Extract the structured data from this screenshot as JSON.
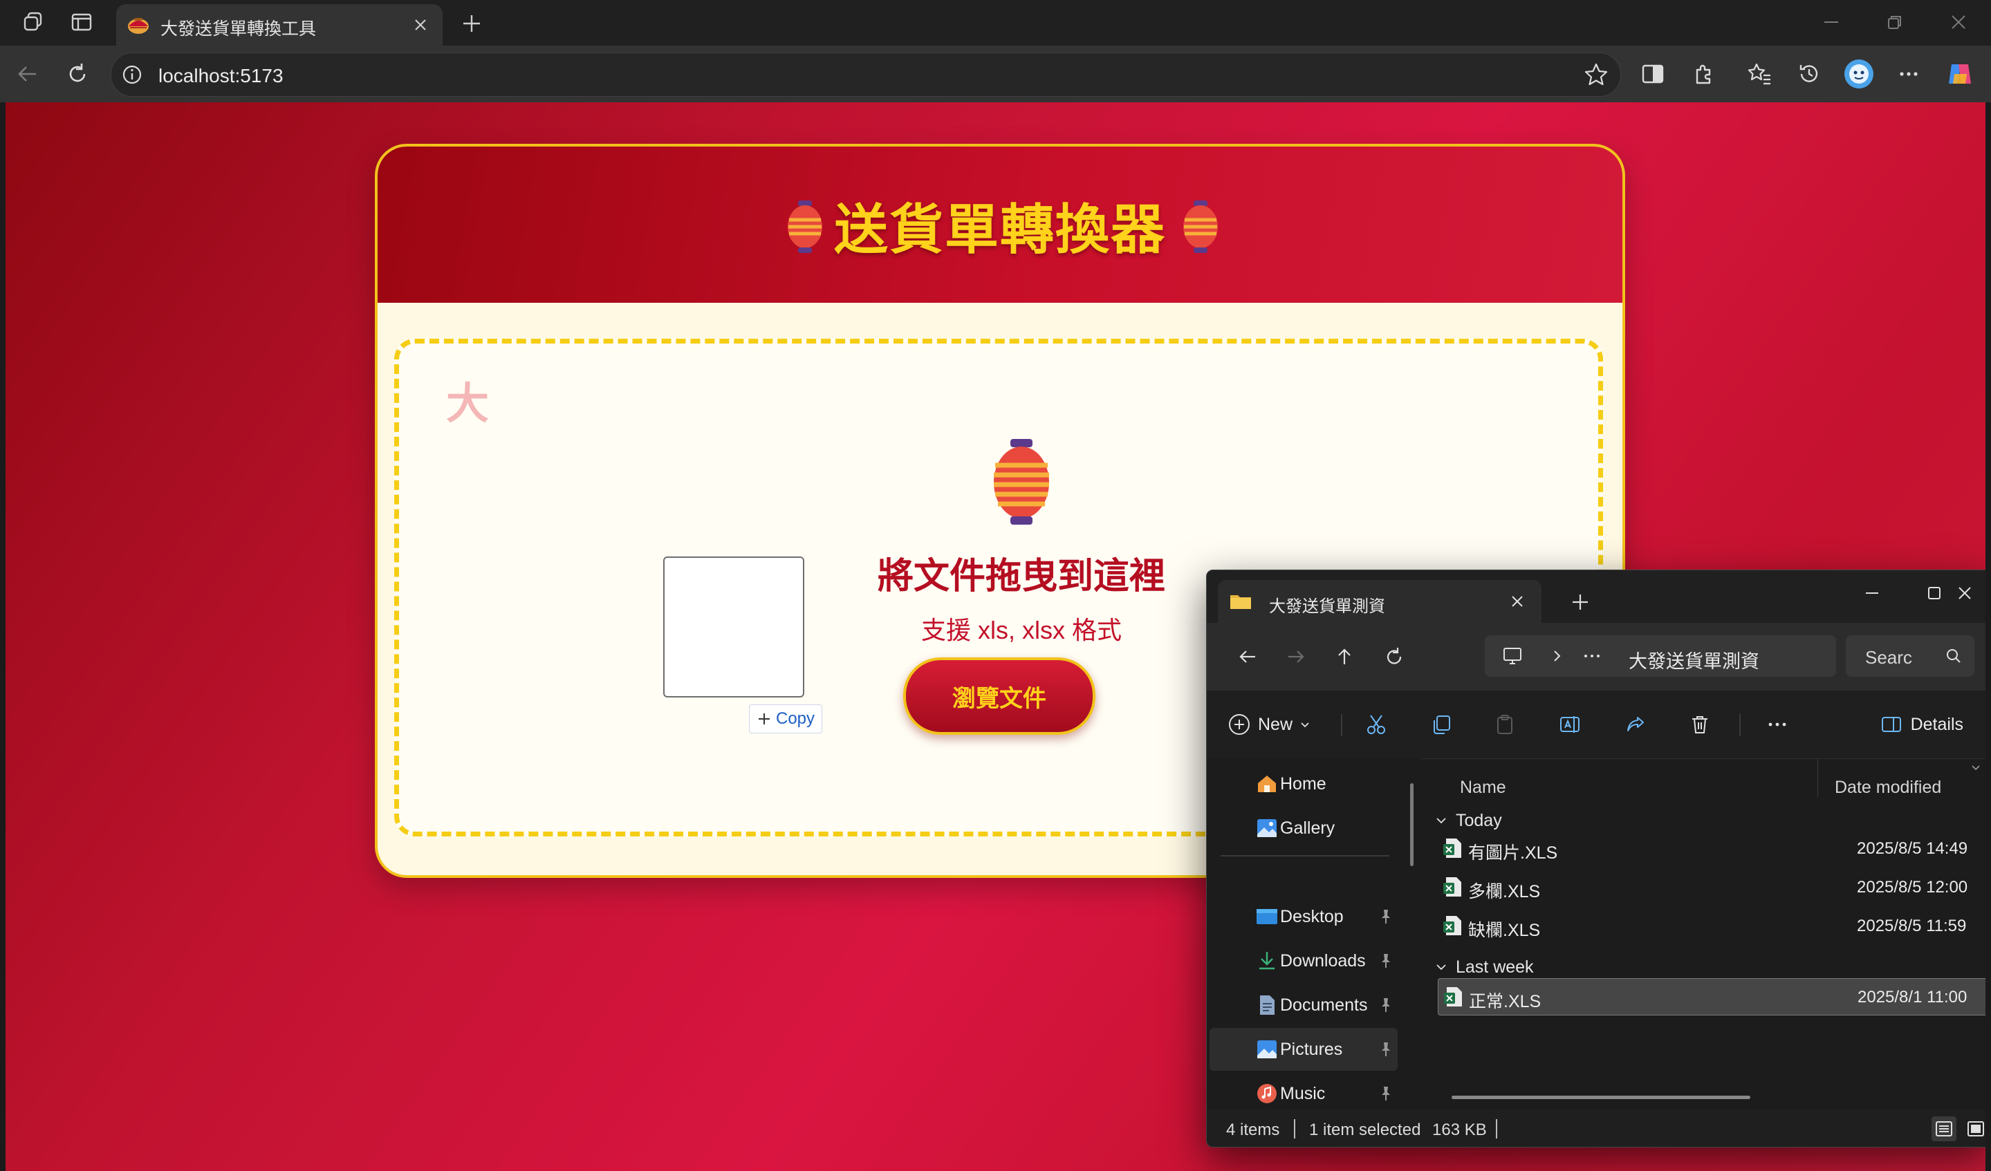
{
  "browser": {
    "tab_title": "大發送貨單轉換工具",
    "url": "localhost:5173"
  },
  "page": {
    "header_title": "送貨單轉換器",
    "corner_char": "大",
    "drop_title": "將文件拖曳到這裡",
    "drop_subtitle": "支援 xls, xlsx 格式",
    "browse_button": "瀏覽文件",
    "copy_badge": "Copy"
  },
  "explorer": {
    "tab_title": "大發送貨單測資",
    "path": "大發送貨單測資",
    "search_placeholder": "Searc",
    "new_label": "New",
    "details_label": "Details",
    "sidebar": [
      {
        "label": "Home",
        "icon": "home-icon",
        "pinned": false
      },
      {
        "label": "Gallery",
        "icon": "gallery-icon",
        "pinned": false
      },
      {
        "label": "Desktop",
        "icon": "desktop-icon",
        "pinned": true
      },
      {
        "label": "Downloads",
        "icon": "downloads-icon",
        "pinned": true
      },
      {
        "label": "Documents",
        "icon": "documents-icon",
        "pinned": true
      },
      {
        "label": "Pictures",
        "icon": "pictures-icon",
        "pinned": true,
        "selected": true
      },
      {
        "label": "Music",
        "icon": "music-icon",
        "pinned": true
      }
    ],
    "columns": {
      "name": "Name",
      "date": "Date modified"
    },
    "groups": [
      {
        "label": "Today",
        "files": [
          {
            "name": "有圖片.XLS",
            "date": "2025/8/5 14:49"
          },
          {
            "name": "多欄.XLS",
            "date": "2025/8/5 12:00"
          },
          {
            "name": "缺欄.XLS",
            "date": "2025/8/5 11:59"
          }
        ]
      },
      {
        "label": "Last week",
        "files": [
          {
            "name": "正常.XLS",
            "date": "2025/8/1 11:00",
            "selected": true
          }
        ]
      }
    ],
    "status": {
      "items": "4 items",
      "selected": "1 item selected",
      "size": "163 KB"
    }
  },
  "colors": {
    "accent_red": "#c8102e",
    "gold": "#f2c21b",
    "title_yellow": "#ffd21b",
    "excel_green": "#1d7044"
  }
}
